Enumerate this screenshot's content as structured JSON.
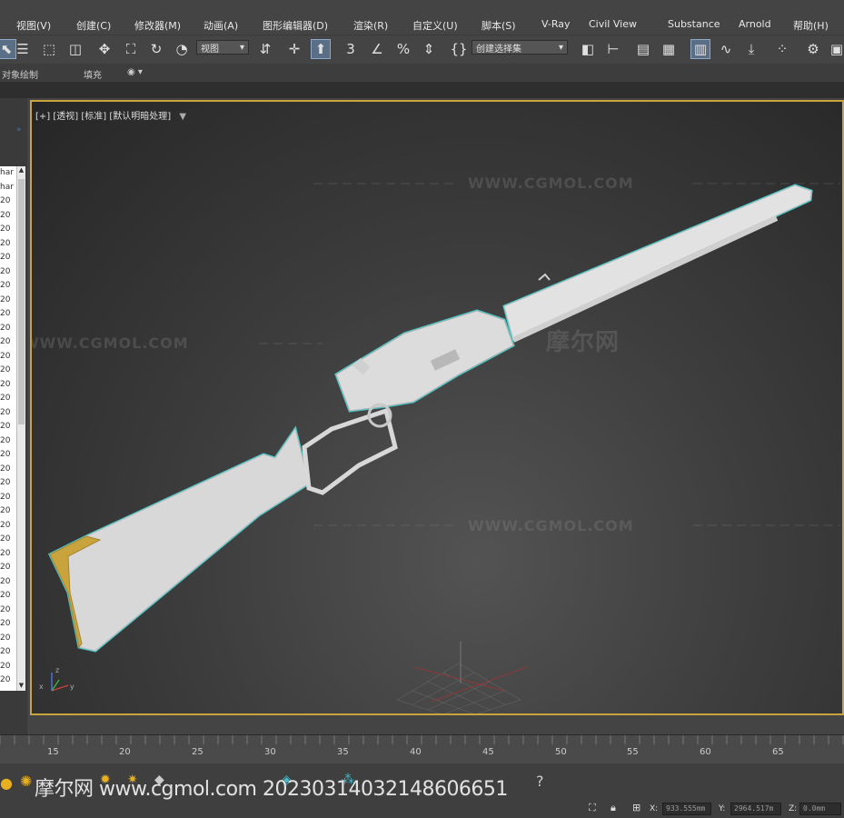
{
  "menu": [
    "视图(V)",
    "创建(C)",
    "修改器(M)",
    "动画(A)",
    "图形编辑器(D)",
    "渲染(R)",
    "自定义(U)",
    "脚本(S)",
    "V-Ray",
    "Civil View",
    "Substance",
    "Arnold",
    "帮助(H)"
  ],
  "toolbar": {
    "view_dropdown": "视图",
    "selection_set_dropdown": "创建选择集",
    "snap_label": "3"
  },
  "ribbon": {
    "object_paint": "对象绘制",
    "fill": "填充"
  },
  "scene_list": [
    "har",
    "har",
    "20",
    "20",
    "20",
    "20",
    "20",
    "20",
    "20",
    "20",
    "20",
    "20",
    "20",
    "20",
    "20",
    "20",
    "20",
    "20",
    "20",
    "20",
    "20",
    "20",
    "20",
    "20",
    "20",
    "20",
    "20",
    "20",
    "20",
    "20",
    "20",
    "20",
    "20",
    "20",
    "20",
    "20",
    "20"
  ],
  "viewport": {
    "label": "[+] [透视] [标准] [默认明暗处理]",
    "watermark_url": "WWW.CGMOL.COM",
    "watermark_logo": "摩尔网"
  },
  "timeline": {
    "ticks": [
      "15",
      "20",
      "25",
      "30",
      "35",
      "40",
      "45",
      "50",
      "55",
      "60",
      "65"
    ]
  },
  "status": {
    "overlay_text": "摩尔网 www.cgmol.com 20230314032148606651",
    "x_label": "X:",
    "x_value": "933.555mm",
    "y_label": "Y:",
    "y_value": "2964.517m",
    "z_label": "Z:",
    "z_value": "0.0mm"
  },
  "colors": {
    "viewport_border": "#c9a43c",
    "selection_outline": "#3fe0e0",
    "model_surface": "#d8d8d8",
    "buttplate": "#c9a43c"
  }
}
